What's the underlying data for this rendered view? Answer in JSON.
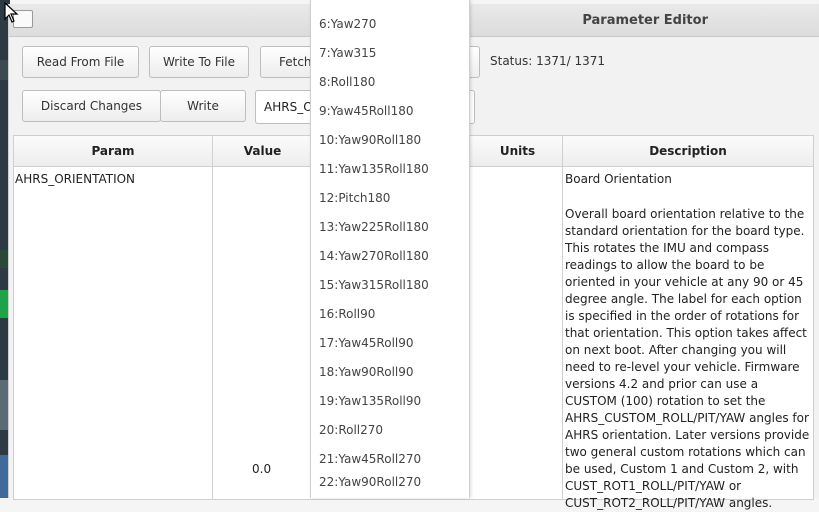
{
  "window": {
    "title": "Parameter Editor"
  },
  "toolbar": {
    "read_from_file": "Read From File",
    "write_to_file": "Write To File",
    "fetch": "Fetch",
    "discard_changes": "Discard Changes",
    "write": "Write",
    "status": "Status: 1371/ 1371",
    "search_value": "AHRS_O"
  },
  "table": {
    "headers": {
      "param": "Param",
      "value": "Value",
      "units": "Units",
      "description": "Description"
    },
    "row": {
      "param": "AHRS_ORIENTATION",
      "value": "0.0",
      "desc_title": "Board Orientation",
      "description": "Overall board orientation relative to the standard orientation for the board type. This rotates the IMU and compass readings to allow the board to be oriented in your vehicle at any 90 or 45 degree angle. The label for each option is specified in the order of rotations for that orientation. This option takes affect on next boot. After changing you will need to re-level your vehicle. Firmware versions 4.2 and prior can use a CUSTOM (100) rotation to set the AHRS_CUSTOM_ROLL/PIT/YAW angles for AHRS orientation. Later versions provide two general custom rotations which can be used, Custom 1 and Custom 2, with CUST_ROT1_ROLL/PIT/YAW or CUST_ROT2_ROLL/PIT/YAW angles."
    }
  },
  "dropdown": {
    "options": [
      "6:Yaw270",
      "7:Yaw315",
      "8:Roll180",
      "9:Yaw45Roll180",
      "10:Yaw90Roll180",
      "11:Yaw135Roll180",
      "12:Pitch180",
      "13:Yaw225Roll180",
      "14:Yaw270Roll180",
      "15:Yaw315Roll180",
      "16:Roll90",
      "17:Yaw45Roll90",
      "18:Yaw90Roll90",
      "19:Yaw135Roll90",
      "20:Roll270",
      "21:Yaw45Roll270",
      "22:Yaw90Roll270"
    ]
  }
}
